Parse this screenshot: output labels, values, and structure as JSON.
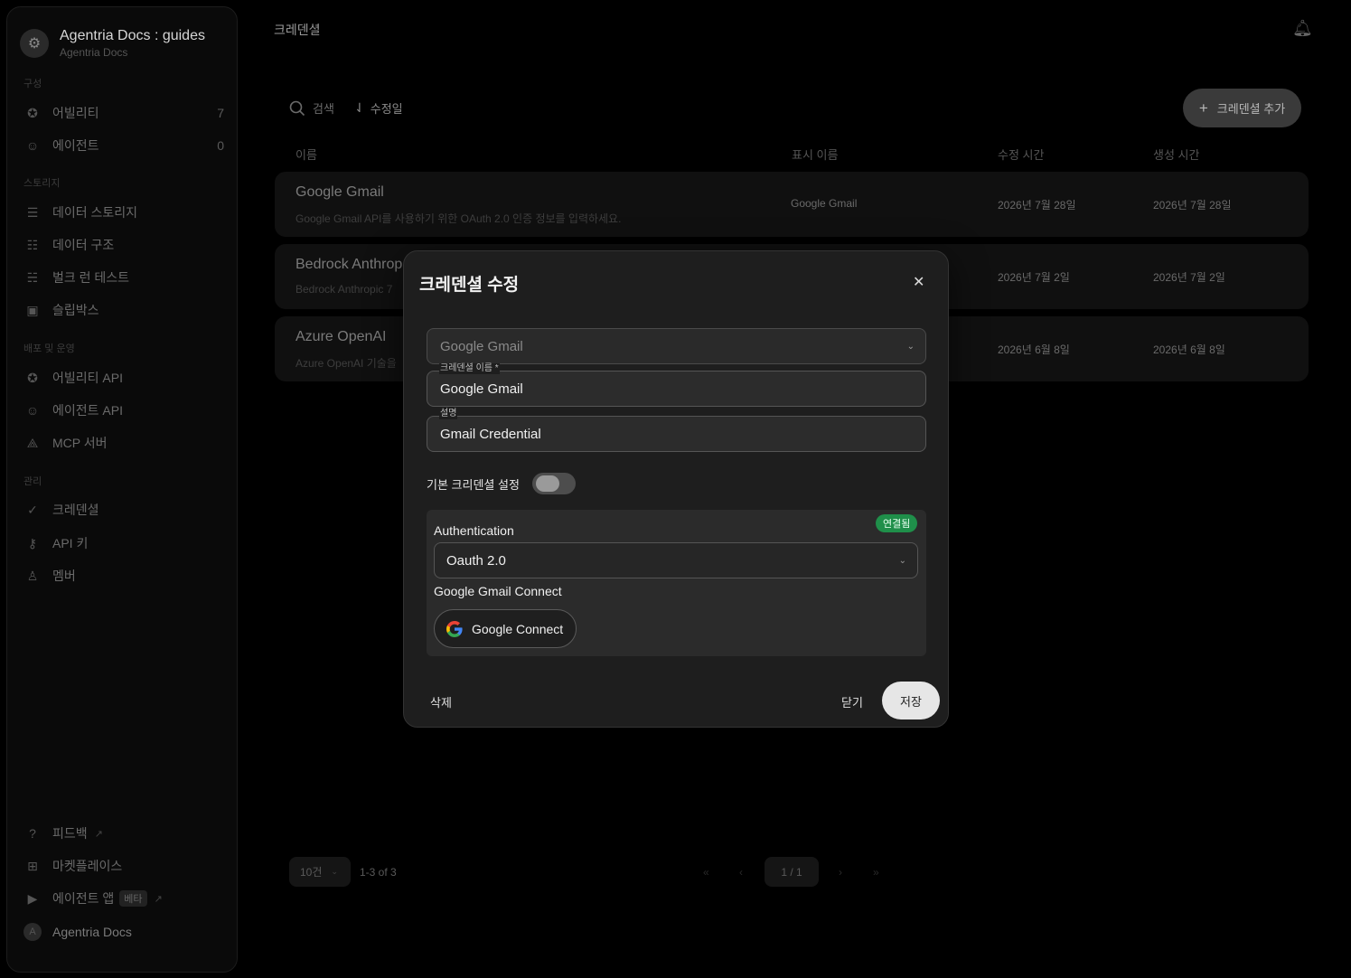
{
  "workspace": {
    "title": "Agentria Docs : guides",
    "subtitle": "Agentria Docs"
  },
  "sidebar": {
    "sections": [
      "구성",
      "스토리지",
      "배포 및 운영",
      "관리"
    ],
    "items": [
      {
        "label": "어빌리티",
        "count": "7"
      },
      {
        "label": "에이전트",
        "count": "0"
      },
      {
        "label": "데이터 스토리지"
      },
      {
        "label": "데이터 구조"
      },
      {
        "label": "벌크 런 테스트"
      },
      {
        "label": "슬립박스"
      },
      {
        "label": "어빌리티 API"
      },
      {
        "label": "에이전트 API"
      },
      {
        "label": "MCP 서버"
      },
      {
        "label": "크레덴셜"
      },
      {
        "label": "API 키"
      },
      {
        "label": "멤버"
      }
    ],
    "footer": [
      {
        "label": "피드백"
      },
      {
        "label": "마켓플레이스"
      },
      {
        "label": "에이전트 앱",
        "badge": "베타"
      },
      {
        "label": "Agentria Docs",
        "avatar": "A"
      }
    ]
  },
  "header": {
    "title": "크레덴셜"
  },
  "toolbar": {
    "search_label": "검색",
    "sort_label": "수정일",
    "add_label": "크레덴셜 추가"
  },
  "table": {
    "columns": [
      "이름",
      "표시 이름",
      "수정 시간",
      "생성 시간"
    ],
    "rows": [
      {
        "name": "Google Gmail",
        "description": "Google Gmail API를 사용하기 위한 OAuth 2.0 인증 정보를 입력하세요.",
        "display": "Google Gmail",
        "modified": "2026년 7월 28일",
        "created": "2026년 7월 28일"
      },
      {
        "name": "Bedrock Anthrop",
        "description": "Bedrock Anthropic 7",
        "display": "",
        "modified": "2026년 7월 2일",
        "created": "2026년 7월 2일"
      },
      {
        "name": "Azure OpenAI",
        "description": "Azure OpenAI 기술을",
        "display": "",
        "modified": "2026년 6월 8일",
        "created": "2026년 6월 8일"
      }
    ]
  },
  "pagination": {
    "page_size": "10건",
    "range": "1-3 of 3",
    "current": "1 / 1"
  },
  "modal": {
    "title": "크레덴셜 수정",
    "type_value": "Google Gmail",
    "name_label": "크레덴셜 이름 *",
    "name_value": "Google Gmail",
    "desc_label": "설명",
    "desc_value": "Gmail Credential",
    "default_label": "기본 크리덴셜 설정",
    "default_on": false,
    "auth_title": "Authentication",
    "auth_status": "연결됨",
    "auth_method": "Oauth 2.0",
    "connect_label": "Google Gmail Connect",
    "connect_button": "Google Connect",
    "delete_label": "삭제",
    "cancel_label": "닫기",
    "save_label": "저장"
  },
  "colors": {
    "accent_green": "#1f8f4a",
    "modal_bg": "#1e1e1e",
    "page_bg": "#000000"
  }
}
